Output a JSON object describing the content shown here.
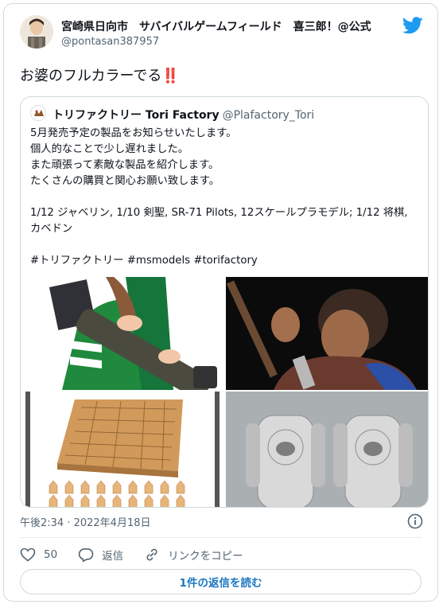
{
  "author": {
    "name": "宮崎県日向市　サバイバルゲームフィールド　喜三郎！@公式",
    "handle": "@pontasan387957",
    "avatar_icon": "person-avatar-icon"
  },
  "platform_icon": "twitter-bird-icon",
  "tweet": {
    "text": "お婆のフルカラーでる",
    "emoji": "‼️"
  },
  "quoted_tweet": {
    "name": "トリファクトリー Tori Factory",
    "handle": "@Plafactory_Tori",
    "lines": [
      "5月発売予定の製品をお知らせいたします。",
      "個人的なことで少し遅れました。",
      "また頑張って素敵な製品を紹介します。",
      "たくさんの購買と関心お願い致します。",
      "",
      "1/12 ジャベリン, 1/10 剣聖, SR-71 Pilots, 12スケールプラモデル; 1/12 将棋, カベドン",
      "",
      "#トリファクトリー #msmodels #torifactory"
    ],
    "images": [
      {
        "name": "javelin-figure-image"
      },
      {
        "name": "sword-saint-figure-image"
      },
      {
        "name": "shogi-board-image"
      },
      {
        "name": "sr71-pilots-image"
      }
    ]
  },
  "meta": {
    "time": "午後2:34 · 2022年4月18日",
    "info_icon": "info-icon"
  },
  "actions": {
    "like_count": "50",
    "reply_label": "返信",
    "copy_link_label": "リンクをコピー"
  },
  "read_replies_label": "1件の返信を読む",
  "colors": {
    "accent": "#1d9bf0",
    "link": "#1d77c2",
    "secondary_text": "#536471",
    "border": "#cfd9de"
  }
}
